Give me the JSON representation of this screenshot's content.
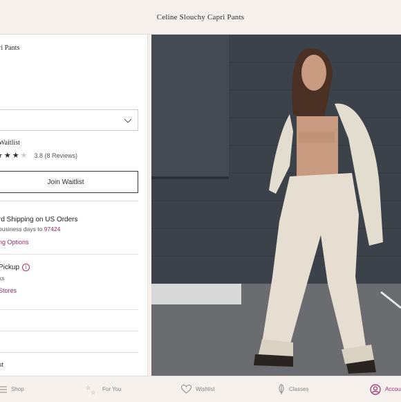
{
  "header": {
    "title": "Celine Slouchy Capri Pants"
  },
  "product": {
    "name_fragment": "ri Pants",
    "waitlist_label": "Waitlist",
    "rating": {
      "stars_filled": 3,
      "stars_total": 4,
      "text": "3.8 (8 Reviews)"
    },
    "join_button": "Join Waitlist"
  },
  "shipping": {
    "title": "rd Shipping on US Orders",
    "sub_prefix": "business days to ",
    "zip": "97424",
    "link": "ng Options"
  },
  "pickup": {
    "title": "Pickup",
    "sub": "ks",
    "link": "Stores"
  },
  "list_label": "st",
  "nav": {
    "shop": "Shop",
    "for_you": "For You",
    "wishlist": "Wishlist",
    "classes": "Classes",
    "account": "Accoun"
  },
  "colors": {
    "accent": "#9b2a6a",
    "background": "#f6f1ec"
  },
  "icons": [
    "chevron-down-icon",
    "star-icon",
    "info-icon",
    "menu-icon",
    "sparkle-icon",
    "heart-icon",
    "feather-icon",
    "account-icon"
  ]
}
